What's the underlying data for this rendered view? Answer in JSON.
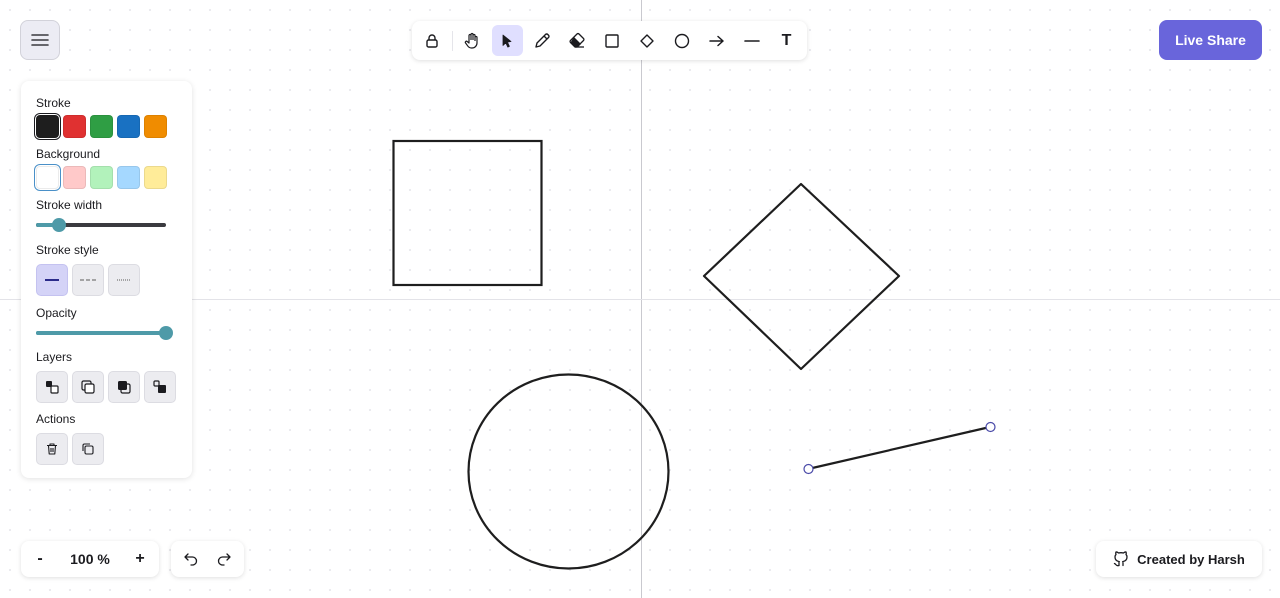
{
  "toolbar": {
    "tools": [
      {
        "name": "lock",
        "icon": "lock-icon",
        "active": false
      },
      {
        "name": "hand",
        "icon": "hand-icon",
        "active": false
      },
      {
        "name": "selection",
        "icon": "pointer-icon",
        "active": true
      },
      {
        "name": "pencil",
        "icon": "pencil-icon",
        "active": false
      },
      {
        "name": "eraser",
        "icon": "eraser-icon",
        "active": false
      },
      {
        "name": "rectangle",
        "icon": "rectangle-icon",
        "active": false
      },
      {
        "name": "diamond",
        "icon": "diamond-icon",
        "active": false
      },
      {
        "name": "ellipse",
        "icon": "ellipse-icon",
        "active": false
      },
      {
        "name": "arrow",
        "icon": "arrow-icon",
        "active": false
      },
      {
        "name": "line",
        "icon": "line-icon",
        "active": false
      },
      {
        "name": "text",
        "icon": "text-icon",
        "active": false
      }
    ],
    "text_tool_glyph": "T"
  },
  "live_share": {
    "label": "Live Share",
    "color": "#6965db"
  },
  "properties": {
    "stroke_label": "Stroke",
    "stroke_colors": [
      "#1e1e1e",
      "#e03131",
      "#2f9e44",
      "#1971c2",
      "#f08c00"
    ],
    "stroke_selected": 0,
    "background_label": "Background",
    "background_colors": [
      "#ffffff",
      "#ffc9c9",
      "#b2f2bb",
      "#a5d8ff",
      "#ffec99"
    ],
    "background_selected": 0,
    "stroke_width_label": "Stroke width",
    "stroke_width_value": 0.18,
    "stroke_style_label": "Stroke style",
    "stroke_styles": [
      "solid",
      "dashed",
      "dotted"
    ],
    "stroke_style_selected": 0,
    "opacity_label": "Opacity",
    "opacity_value": 1.0,
    "layers_label": "Layers",
    "layer_actions": [
      "send-to-back",
      "send-backward",
      "bring-forward",
      "bring-to-front"
    ],
    "actions_label": "Actions",
    "actions": [
      "delete",
      "duplicate"
    ],
    "accent": "#4e9aa8"
  },
  "zoom": {
    "minus": "-",
    "value": "100 %",
    "plus": "+"
  },
  "history": {
    "undo": "undo",
    "redo": "redo"
  },
  "credit": {
    "label": "Created by Harsh",
    "icon": "github-icon"
  },
  "canvas": {
    "shapes": [
      "rectangle",
      "diamond",
      "ellipse",
      "line"
    ],
    "stroke_color": "#1e1e1e",
    "selected_shape": "line"
  }
}
